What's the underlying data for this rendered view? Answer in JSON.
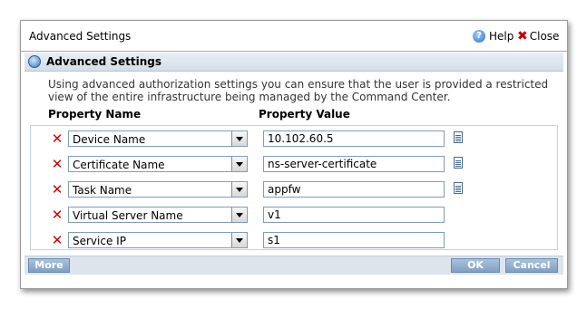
{
  "window": {
    "title": "Advanced Settings",
    "help_label": "Help",
    "close_label": "Close"
  },
  "section": {
    "title": "Advanced Settings",
    "description": "Using advanced authorization settings you can ensure that the user is provided a restricted view of the entire infrastructure being managed by the Command Center."
  },
  "table": {
    "headers": {
      "name": "Property Name",
      "value": "Property Value"
    },
    "rows": [
      {
        "property": "Device Name",
        "value": "10.102.60.5",
        "has_picker": true
      },
      {
        "property": "Certificate Name",
        "value": "ns-server-certificate",
        "has_picker": true
      },
      {
        "property": "Task Name",
        "value": "appfw",
        "has_picker": true
      },
      {
        "property": "Virtual Server Name",
        "value": "v1",
        "has_picker": false
      },
      {
        "property": "Service IP",
        "value": "s1",
        "has_picker": false
      }
    ]
  },
  "footer": {
    "more_label": "More",
    "ok_label": "OK",
    "cancel_label": "Cancel"
  },
  "colors": {
    "delete_icon": "#d00000",
    "button_bg": "#8fadcf",
    "footer_bg": "#dde4ec",
    "header_bg": "#dfe6ee"
  },
  "icons": {
    "delete": "delete-x-icon",
    "picker": "document-picker-icon",
    "help": "help-icon",
    "close": "close-icon",
    "section": "settings-globe-icon"
  }
}
